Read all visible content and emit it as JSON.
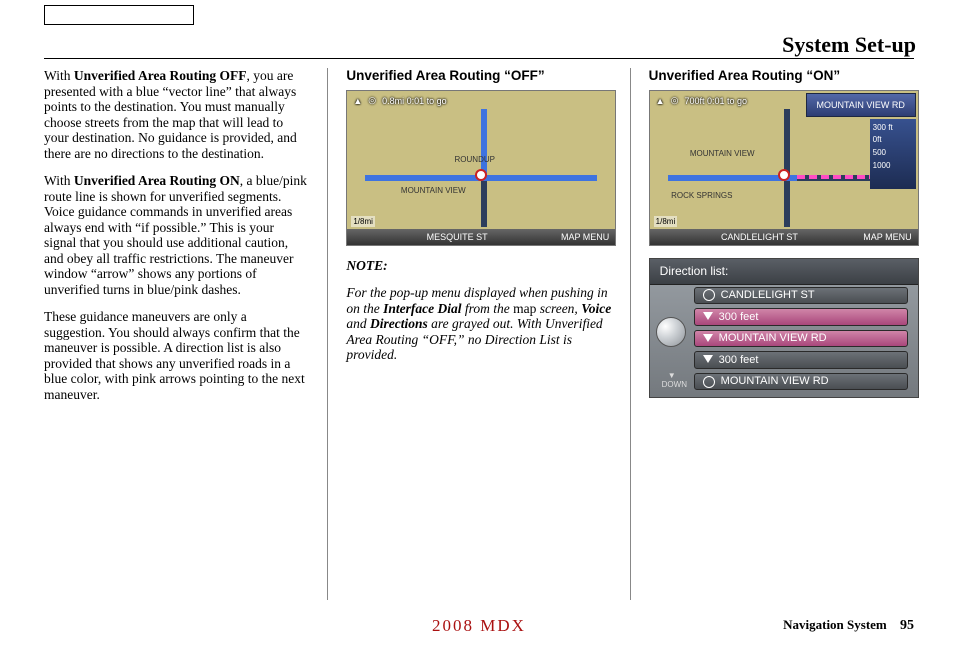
{
  "page_title": "System Set-up",
  "col1": {
    "p1_a": "With ",
    "p1_b": "Unverified Area Routing OFF",
    "p1_c": ", you are presented with a blue “vector line” that always points to the destination. You must manually choose streets from the map that will lead to your destination. No guidance is provided, and there are no directions to the destination.",
    "p2_a": "With ",
    "p2_b": "Unverified Area Routing ON",
    "p2_c": ", a blue/pink route line is shown for unverified segments. Voice guidance commands in unverified areas always end with “if possible.” This is your signal that you should use additional caution, and obey all traffic restrictions. The maneuver window “arrow” shows any portions of unverified turns in blue/pink dashes.",
    "p3": "These guidance maneuvers are only a suggestion. You should always confirm that the maneuver is possible. A direction list is also provided that shows any unverified roads in a blue color, with pink arrows pointing to the next maneuver."
  },
  "col2": {
    "heading": "Unverified Area Routing “OFF”",
    "map": {
      "topinfo": "0.8mi 0:01 to go",
      "scale": "1/8mi",
      "bottom_street": "MESQUITE ST",
      "menu": "MAP MENU",
      "street1": "ROUNDUP",
      "street2": "MOUNTAIN VIEW"
    },
    "note_label": "NOTE:",
    "note_a": "For the pop-up menu displayed when pushing in on the ",
    "note_b": "Interface Dial",
    "note_c": " from the ",
    "note_d": "map",
    "note_e": " screen, ",
    "note_f": "Voice",
    "note_g": " and ",
    "note_h": "Directions",
    "note_i": " are grayed out. With Unverified Area Routing “OFF,” no Direction List is provided."
  },
  "col3": {
    "heading": "Unverified Area Routing “ON”",
    "map": {
      "topinfo": "700ft 0:01 to go",
      "topright": "MOUNTAIN VIEW RD",
      "scale_vals": [
        "300 ft",
        "0ft",
        "500",
        "1000"
      ],
      "scale": "1/8mi",
      "bottom_street": "CANDLELIGHT ST",
      "menu": "MAP MENU",
      "street1": "MOUNTAIN VIEW",
      "street2": "ROCK SPRINGS"
    },
    "dirlist": {
      "title": "Direction list:",
      "rows": [
        "CANDLELIGHT ST",
        "300 feet",
        "MOUNTAIN VIEW RD",
        "300 feet",
        "MOUNTAIN VIEW RD"
      ],
      "down": "DOWN"
    }
  },
  "footer": {
    "model": "2008  MDX",
    "section": "Navigation System",
    "page": "95"
  }
}
